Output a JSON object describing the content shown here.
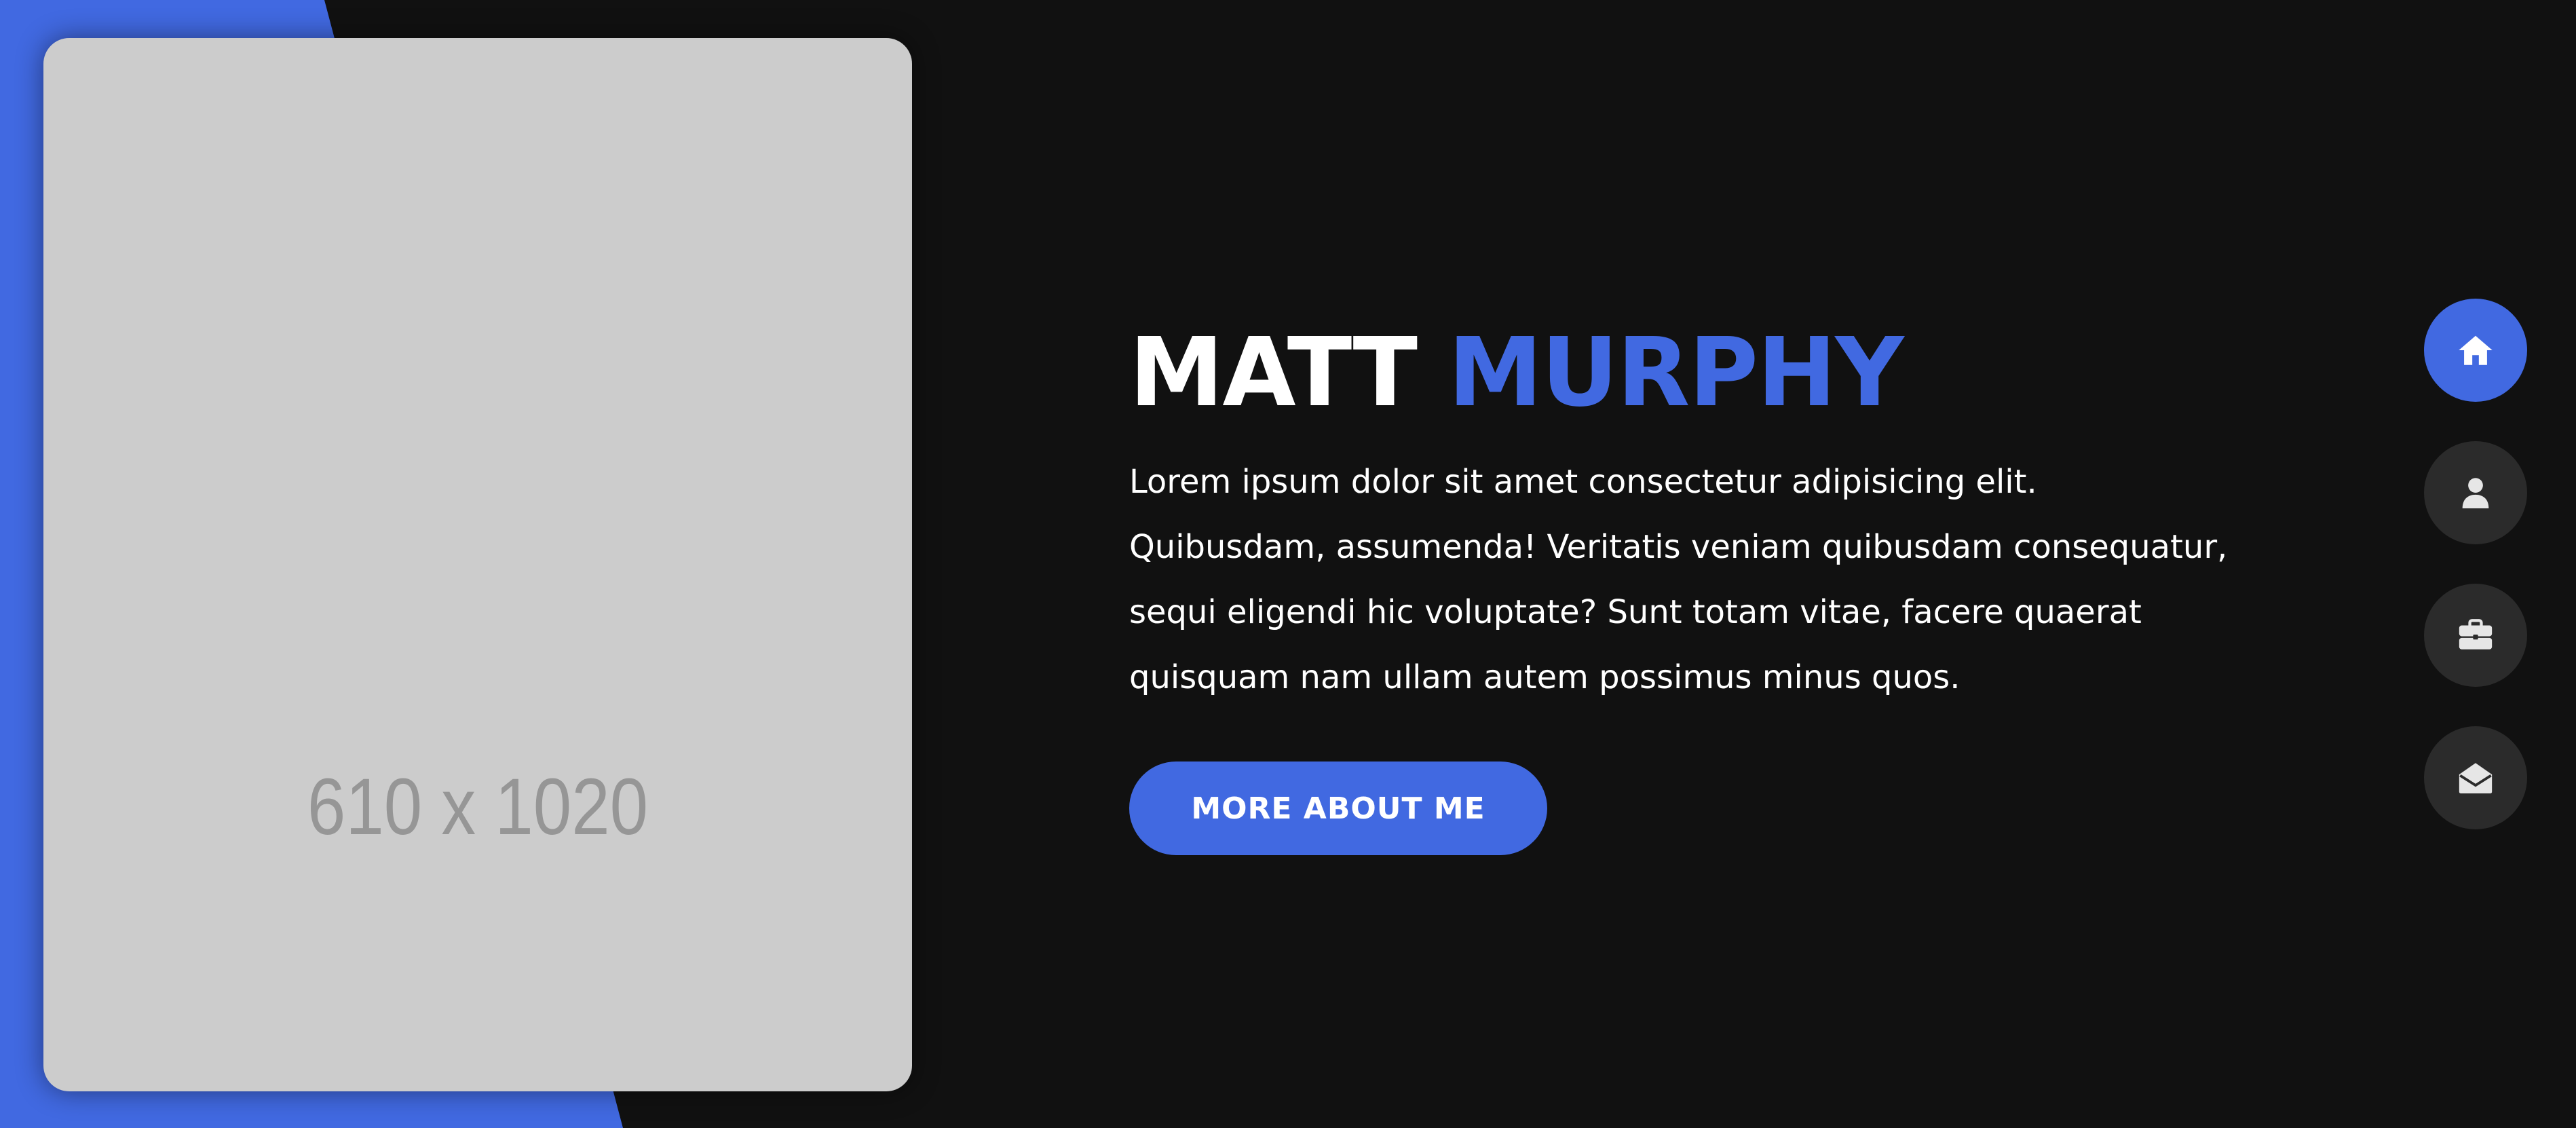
{
  "colors": {
    "accent": "#4169e1",
    "background": "#111111",
    "nav_inactive": "#2b2b2b",
    "placeholder": "#cccccc"
  },
  "hero": {
    "image_placeholder": "610 x 1020",
    "first_name": "MATT",
    "last_name": "MURPHY",
    "description": "Lorem ipsum dolor sit amet consectetur adipisicing elit. Quibusdam, assumenda! Veritatis veniam quibusdam consequatur, sequi eligendi hic voluptate? Sunt totam vitae, facere quaerat quisquam nam ullam autem possimus minus quos.",
    "cta_label": "MORE ABOUT ME"
  },
  "nav": {
    "items": [
      {
        "icon": "home-icon",
        "active": true
      },
      {
        "icon": "user-icon",
        "active": false
      },
      {
        "icon": "briefcase-icon",
        "active": false
      },
      {
        "icon": "envelope-open-icon",
        "active": false
      }
    ]
  }
}
